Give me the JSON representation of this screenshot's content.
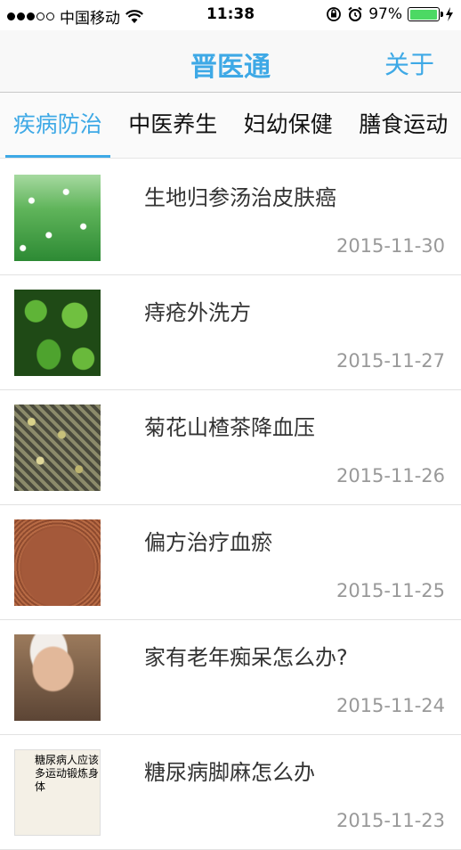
{
  "status_bar": {
    "carrier": "中国移动",
    "time": "11:38",
    "battery_pct": "97%",
    "battery_level": 0.97,
    "battery_color": "#4cd964"
  },
  "nav": {
    "title": "晋医通",
    "about_label": "关于",
    "accent_color": "#3ea9e6"
  },
  "tabs": [
    {
      "label": "疾病防治",
      "active": true
    },
    {
      "label": "中医养生",
      "active": false
    },
    {
      "label": "妇幼保健",
      "active": false
    },
    {
      "label": "膳食运动",
      "active": false
    }
  ],
  "articles": [
    {
      "title": "生地归参汤治皮肤癌",
      "date": "2015-11-30"
    },
    {
      "title": "痔疮外洗方",
      "date": "2015-11-27"
    },
    {
      "title": "菊花山楂茶降血压",
      "date": "2015-11-26"
    },
    {
      "title": "偏方治疗血瘀",
      "date": "2015-11-25"
    },
    {
      "title": "家有老年痴呆怎么办?",
      "date": "2015-11-24"
    },
    {
      "title": "糖尿病脚麻怎么办",
      "date": "2015-11-23",
      "thumb_caption": "糖尿病人应该多运动锻炼身体"
    }
  ]
}
